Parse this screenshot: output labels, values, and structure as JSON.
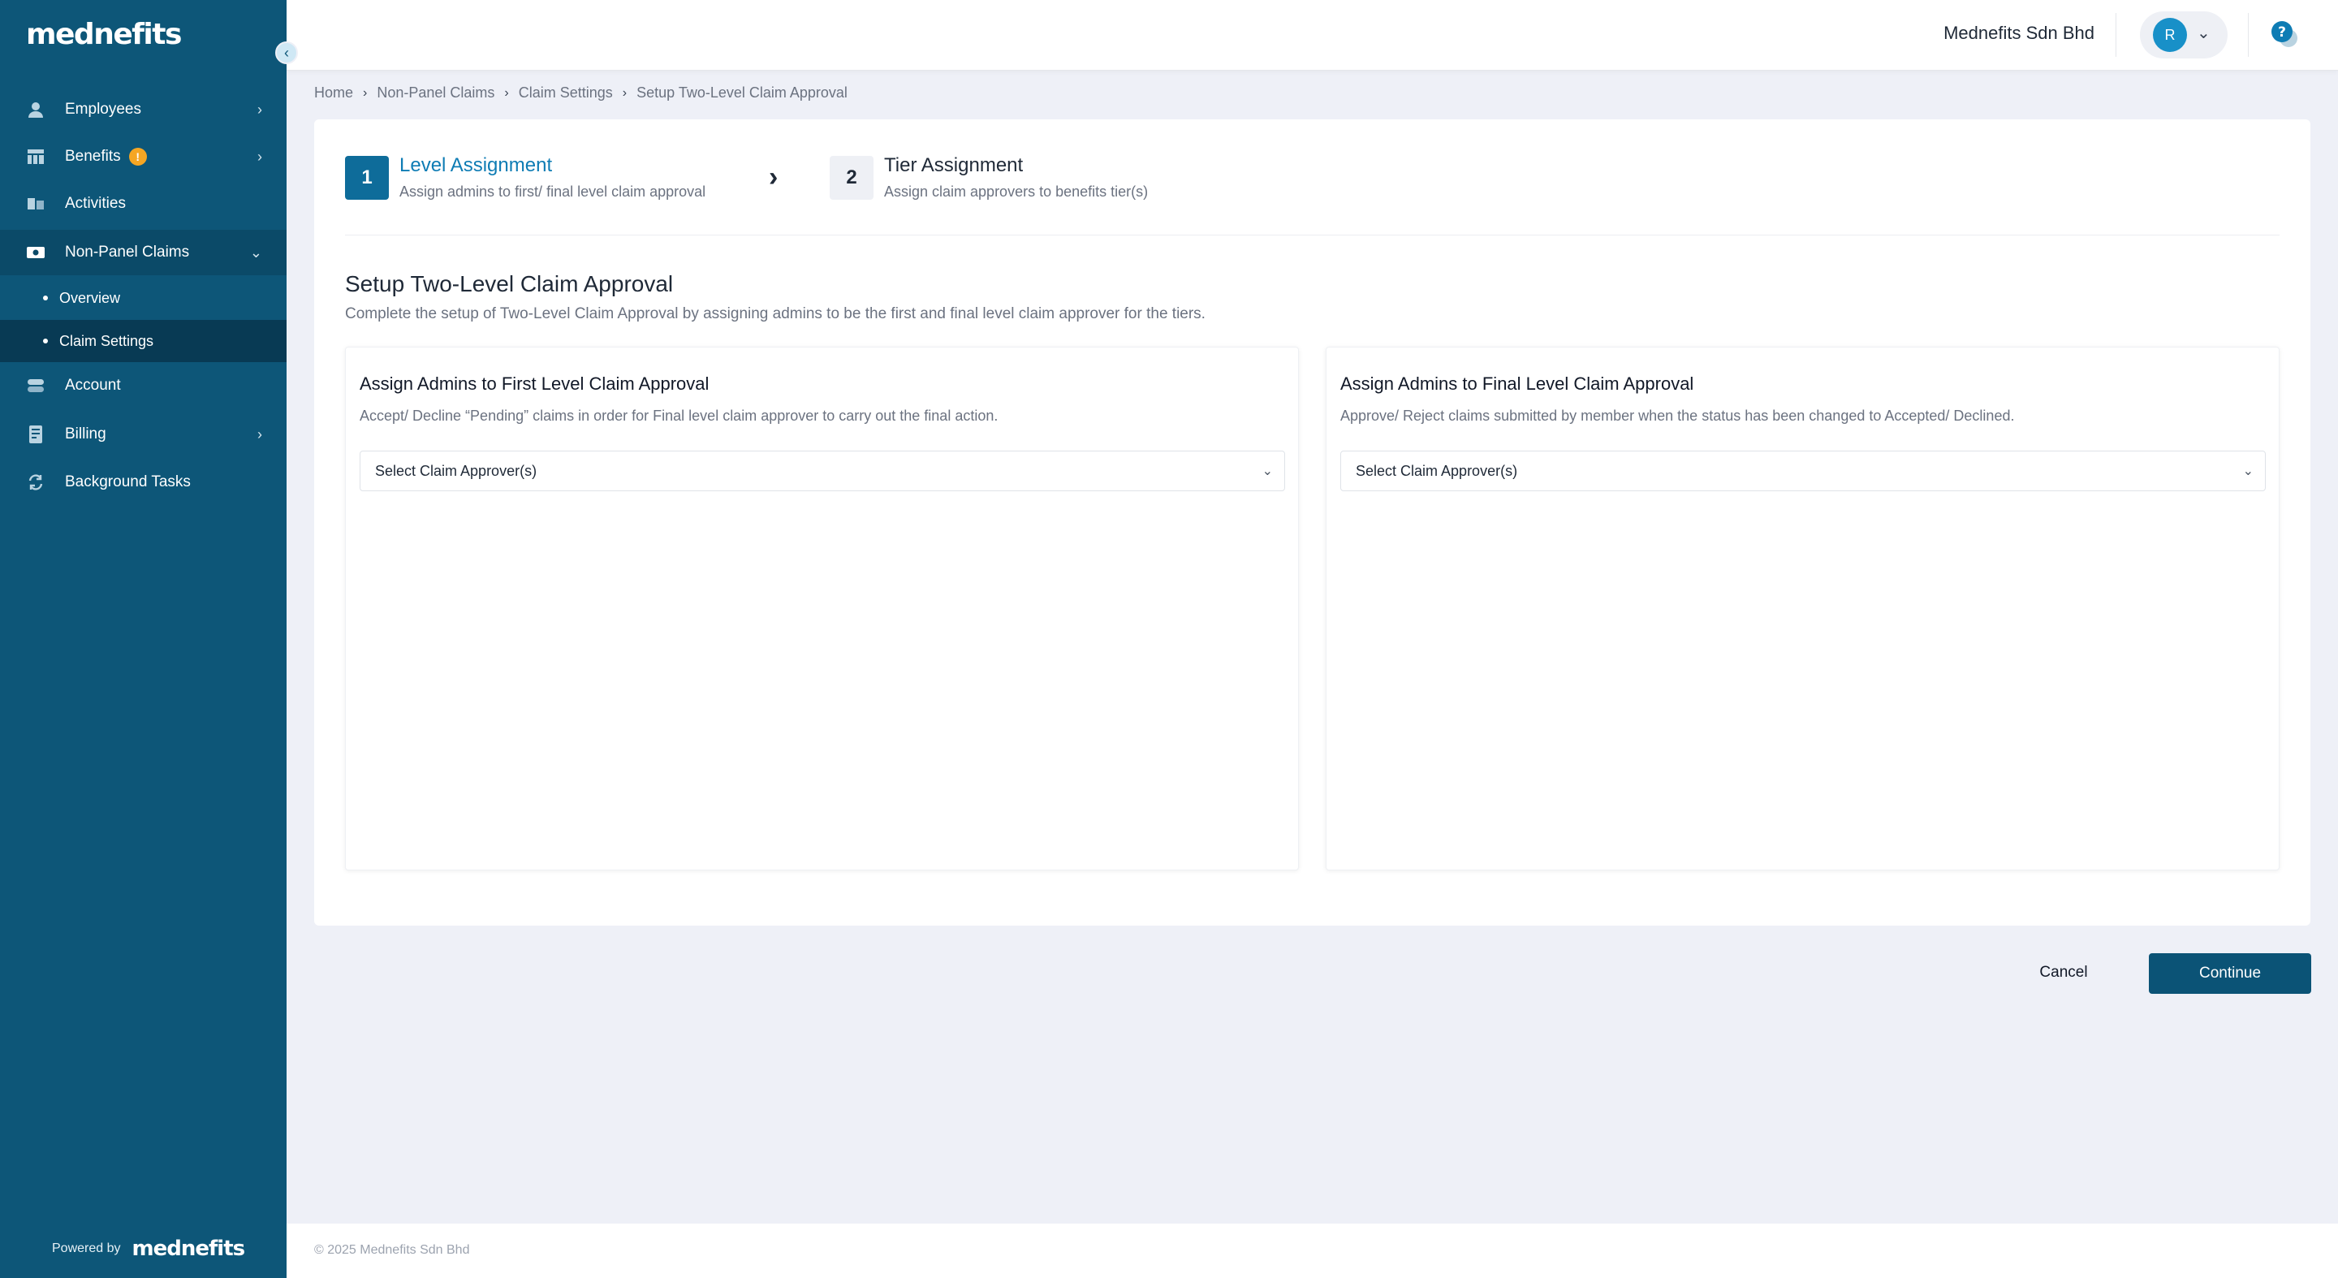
{
  "brand": {
    "logo": "mednefits",
    "accent_color": "#0d5678",
    "powered_by": "Powered by",
    "powered_logo": "mednefits"
  },
  "sidebar": {
    "items": [
      {
        "label": "Employees",
        "icon": "user-icon",
        "has_children": true
      },
      {
        "label": "Benefits",
        "icon": "table-icon",
        "badge": "!",
        "has_children": true
      },
      {
        "label": "Activities",
        "icon": "activities-icon",
        "has_children": false
      },
      {
        "label": "Non-Panel Claims",
        "icon": "money-icon",
        "expanded": true
      },
      {
        "label": "Account",
        "icon": "account-icon",
        "has_children": false
      },
      {
        "label": "Billing",
        "icon": "billing-icon",
        "has_children": true
      },
      {
        "label": "Background Tasks",
        "icon": "refresh-icon",
        "has_children": false
      }
    ],
    "subitems": [
      {
        "label": "Overview"
      },
      {
        "label": "Claim Settings",
        "current": true
      }
    ]
  },
  "header": {
    "company": "Mednefits Sdn Bhd",
    "avatar_initial": "R",
    "help": "?"
  },
  "breadcrumb": [
    "Home",
    "Non-Panel Claims",
    "Claim Settings",
    "Setup Two-Level Claim Approval"
  ],
  "steps": [
    {
      "number": "1",
      "title": "Level Assignment",
      "desc": "Assign admins to first/ final level claim approval",
      "active": true
    },
    {
      "number": "2",
      "title": "Tier Assignment",
      "desc": "Assign claim approvers to benefits tier(s)",
      "active": false
    }
  ],
  "section": {
    "title": "Setup Two-Level Claim Approval",
    "desc": "Complete the setup of Two-Level Claim Approval by assigning admins to be the first and final level claim approver for the tiers."
  },
  "panels": [
    {
      "title": "Assign Admins to First Level Claim Approval",
      "desc": "Accept/ Decline “Pending” claims in order for Final level claim approver to carry out the final action.",
      "select": "Select Claim Approver(s)"
    },
    {
      "title": "Assign Admins to Final Level Claim Approval",
      "desc": "Approve/ Reject claims submitted by member when the status has been changed to Accepted/ Declined.",
      "select": "Select Claim Approver(s)"
    }
  ],
  "actions": {
    "cancel": "Cancel",
    "continue": "Continue"
  },
  "footer": {
    "copyright": "© 2025 Mednefits Sdn Bhd"
  }
}
